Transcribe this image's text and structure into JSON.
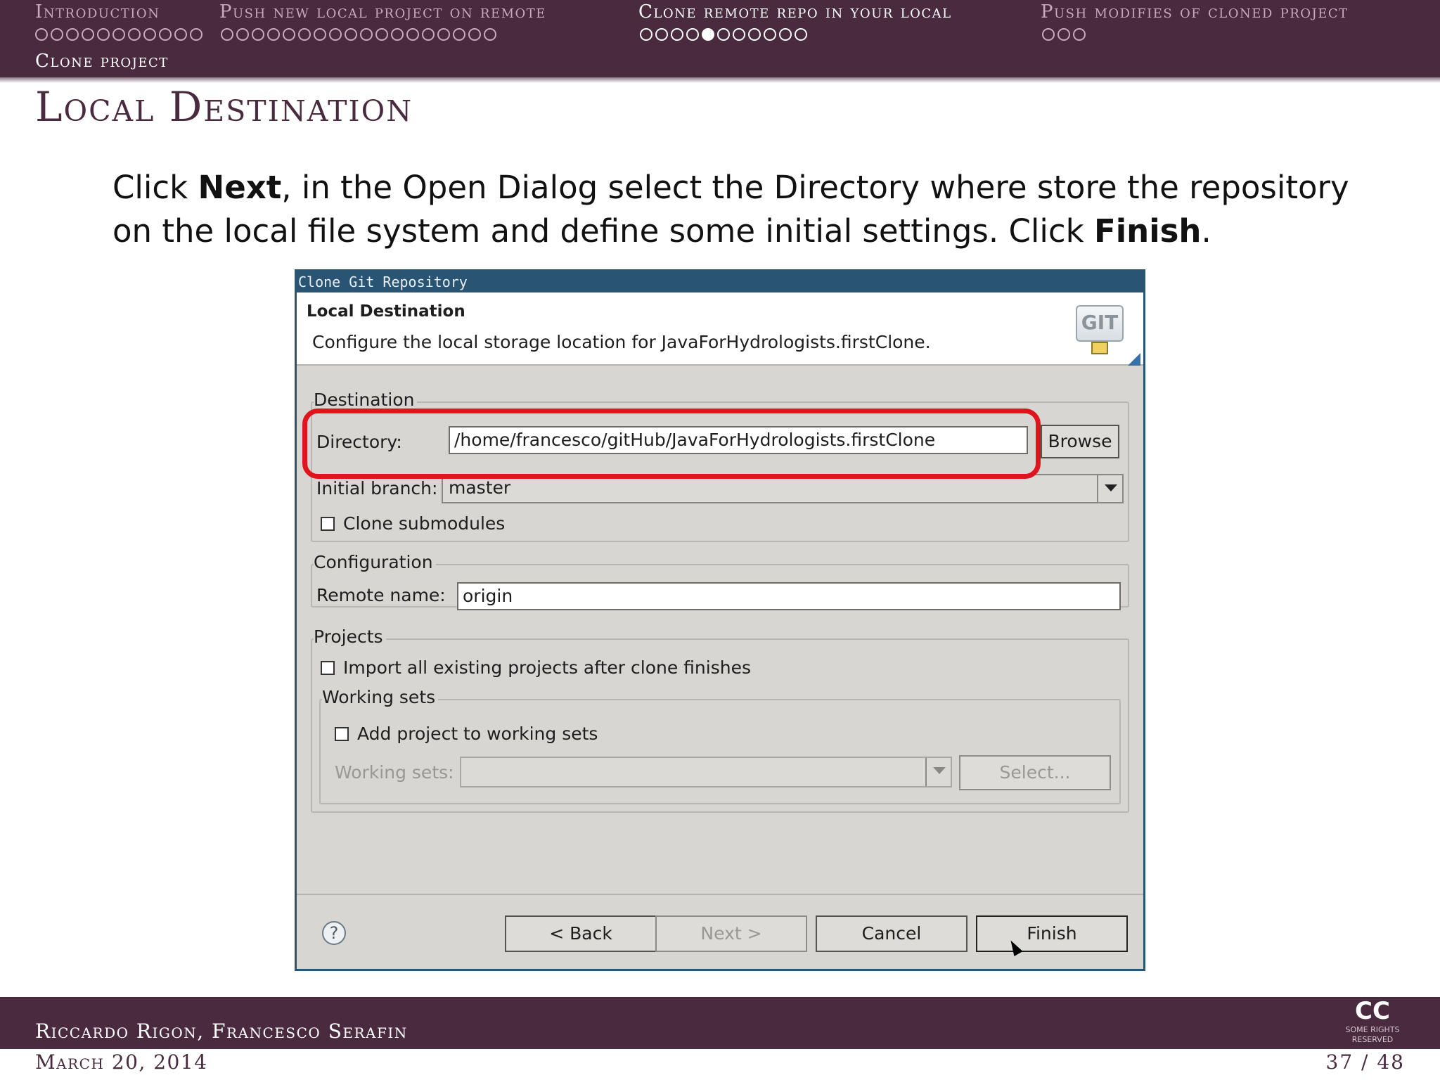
{
  "nav": {
    "sections": [
      {
        "label": "Introduction",
        "dots": 11,
        "filled": -1,
        "active": false
      },
      {
        "label": "Push new local project on remote",
        "dots": 18,
        "filled": -1,
        "active": false
      },
      {
        "label": "Clone remote repo in your local",
        "dots": 11,
        "filled": 4,
        "active": true
      },
      {
        "label": "Push modifies of cloned project",
        "dots": 3,
        "filled": -1,
        "active": false
      }
    ],
    "subsection": "Clone project"
  },
  "frame_title": "Local Destination",
  "body": {
    "part1": "Click ",
    "next_bold": "Next",
    "part2": ", in the Open Dialog select the Directory where store the repository on the local file system and define some initial settings.  Click ",
    "finish_bold": "Finish",
    "part3": "."
  },
  "dialog": {
    "title": "Clone Git Repository",
    "banner_title": "Local Destination",
    "banner_desc": "Configure the local storage location for JavaForHydrologists.firstClone.",
    "git_icon_text": "GIT",
    "destination": {
      "group_label": "Destination",
      "directory_label": "Directory:",
      "directory_value": "/home/francesco/gitHub/JavaForHydrologists.firstClone",
      "browse_label": "Browse",
      "branch_label": "Initial branch:",
      "branch_value": "master",
      "clone_submodules_label": "Clone submodules"
    },
    "configuration": {
      "group_label": "Configuration",
      "remote_name_label": "Remote name:",
      "remote_name_value": "origin"
    },
    "projects": {
      "group_label": "Projects",
      "import_label": "Import all existing projects after clone finishes",
      "working_sets_group": "Working sets",
      "add_project_label": "Add project to working sets",
      "working_sets_label": "Working sets:",
      "select_label": "Select..."
    },
    "buttons": {
      "help": "?",
      "back": "< Back",
      "next": "Next >",
      "cancel": "Cancel",
      "finish": "Finish"
    }
  },
  "footer": {
    "authors": "Riccardo Rigon, Francesco Serafin",
    "date": "March 20, 2014",
    "page": "37 / 48",
    "cc_big": "CC",
    "cc_small": "SOME RIGHTS RESERVED"
  },
  "colors": {
    "theme": "#4a2a3e",
    "highlight": "#e0141c",
    "dialog_title": "#2a5474"
  }
}
